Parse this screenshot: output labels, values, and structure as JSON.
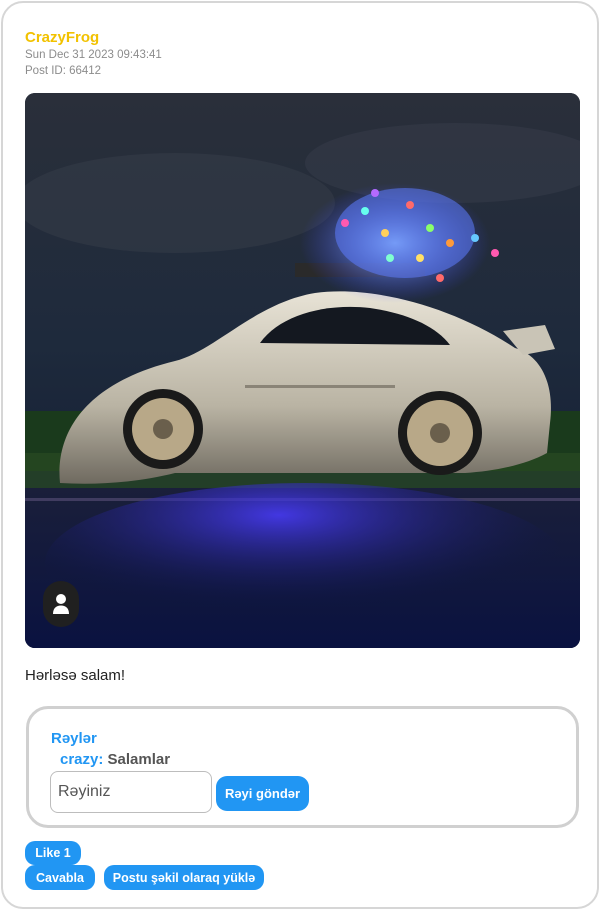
{
  "post": {
    "username": "CrazyFrog",
    "date": "Sun Dec 31 2023 09:43:41",
    "post_id": "Post ID: 66412",
    "caption": "Hərləsə salam!",
    "image_icon": "user-icon"
  },
  "comments": {
    "title": "Rəylər",
    "items": [
      {
        "author": "crazy:",
        "text": "Salamlar"
      }
    ],
    "input_placeholder": "Rəyiniz",
    "send_label": "Rəyi göndər"
  },
  "actions": {
    "like_label": "Like 1",
    "reply_label": "Cavabla",
    "download_label": "Postu şəkil olaraq yüklə"
  },
  "colors": {
    "username": "#f2c200",
    "accent": "#2196f3",
    "border": "#d0d0d0"
  }
}
